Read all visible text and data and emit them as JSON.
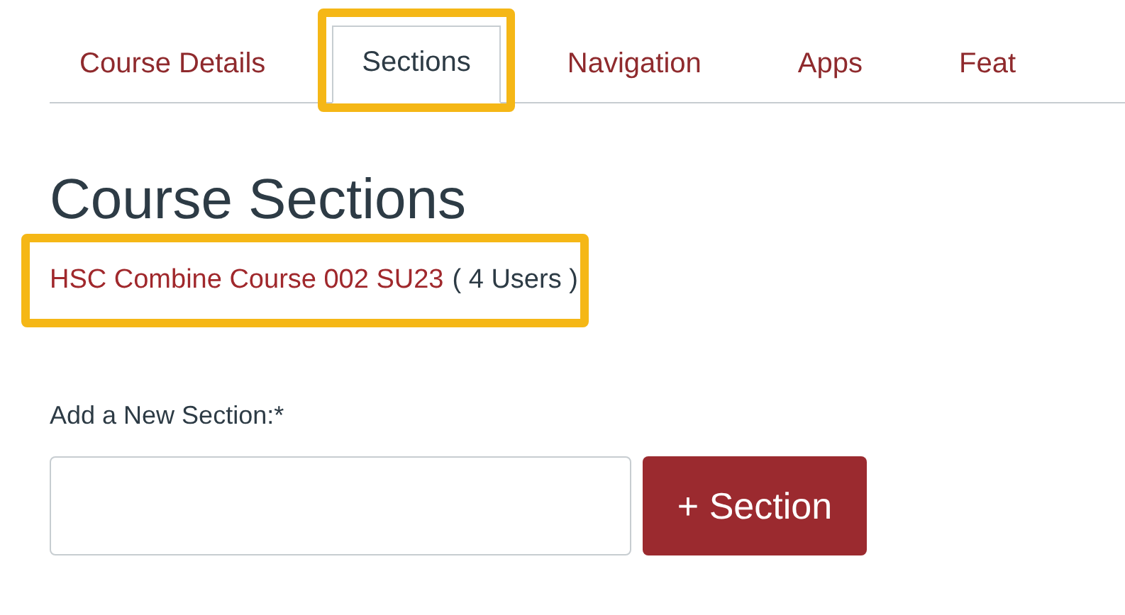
{
  "tabs": [
    {
      "label": "Course Details",
      "selected": false,
      "highlighted": false
    },
    {
      "label": "Sections",
      "selected": true,
      "highlighted": true
    },
    {
      "label": "Navigation",
      "selected": false,
      "highlighted": false
    },
    {
      "label": "Apps",
      "selected": false,
      "highlighted": false
    },
    {
      "label": "Feat",
      "selected": false,
      "highlighted": false
    }
  ],
  "heading": "Course Sections",
  "sections": [
    {
      "name": "HSC Combine Course 002 SU23",
      "users": "( 4 Users )",
      "highlighted": true
    }
  ],
  "new_section": {
    "label": "Add a New Section:*",
    "button": "+ Section"
  }
}
